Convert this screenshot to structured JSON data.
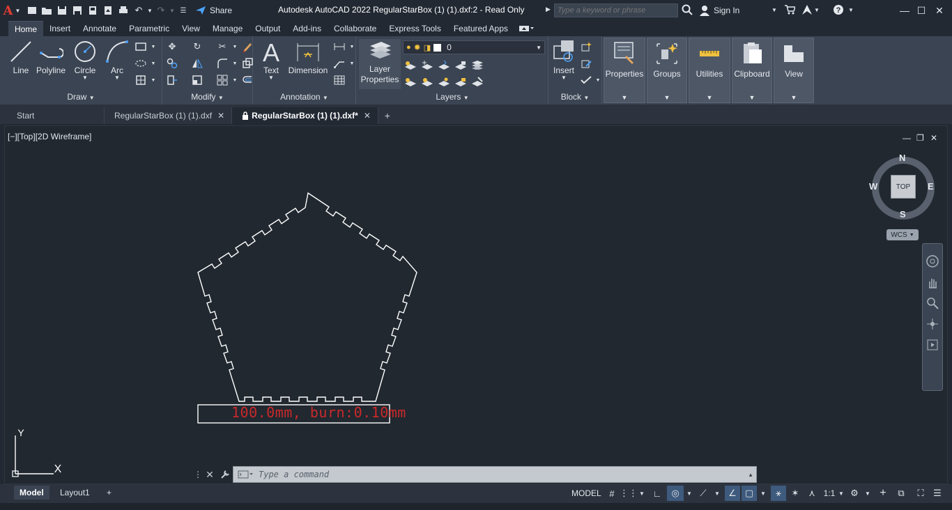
{
  "titlebar": {
    "title": "Autodesk AutoCAD 2022    RegularStarBox (1) (1).dxf:2 - Read Only",
    "share_label": "Share",
    "search_placeholder": "Type a keyword or phrase",
    "sign_in": "Sign In"
  },
  "ribbon_tabs": [
    "Home",
    "Insert",
    "Annotate",
    "Parametric",
    "View",
    "Manage",
    "Output",
    "Add-ins",
    "Collaborate",
    "Express Tools",
    "Featured Apps"
  ],
  "ribbon": {
    "draw": {
      "title": "Draw",
      "line": "Line",
      "polyline": "Polyline",
      "circle": "Circle",
      "arc": "Arc"
    },
    "modify": {
      "title": "Modify"
    },
    "annotation": {
      "title": "Annotation",
      "text": "Text",
      "dimension": "Dimension"
    },
    "layers": {
      "title": "Layers",
      "layer_properties_1": "Layer",
      "layer_properties_2": "Properties",
      "current_layer": "0"
    },
    "block": {
      "title": "Block",
      "insert": "Insert"
    },
    "properties": "Properties",
    "groups": "Groups",
    "utilities": "Utilities",
    "clipboard": "Clipboard",
    "view": "View"
  },
  "file_tabs": {
    "start": "Start",
    "tab1": "RegularStarBox (1) (1).dxf",
    "tab2": "RegularStarBox (1) (1).dxf*"
  },
  "viewport": {
    "label": "[−][Top][2D Wireframe]",
    "viewcube": {
      "n": "N",
      "s": "S",
      "e": "E",
      "w": "W",
      "face": "TOP"
    },
    "wcs": "WCS",
    "drawing_text": "100.0mm,  burn:0.10mm",
    "ucs_x": "X",
    "ucs_y": "Y"
  },
  "command": {
    "placeholder": "Type  a  command"
  },
  "statusbar": {
    "model_tab": "Model",
    "layout_tab": "Layout1",
    "model_space": "MODEL",
    "scale": "1:1"
  },
  "colors": {
    "background": "#212830",
    "ribbon": "#3b4452",
    "accent_red": "#e03b32",
    "drawing_text": "#d42a2a",
    "geometry": "#ffffff"
  }
}
